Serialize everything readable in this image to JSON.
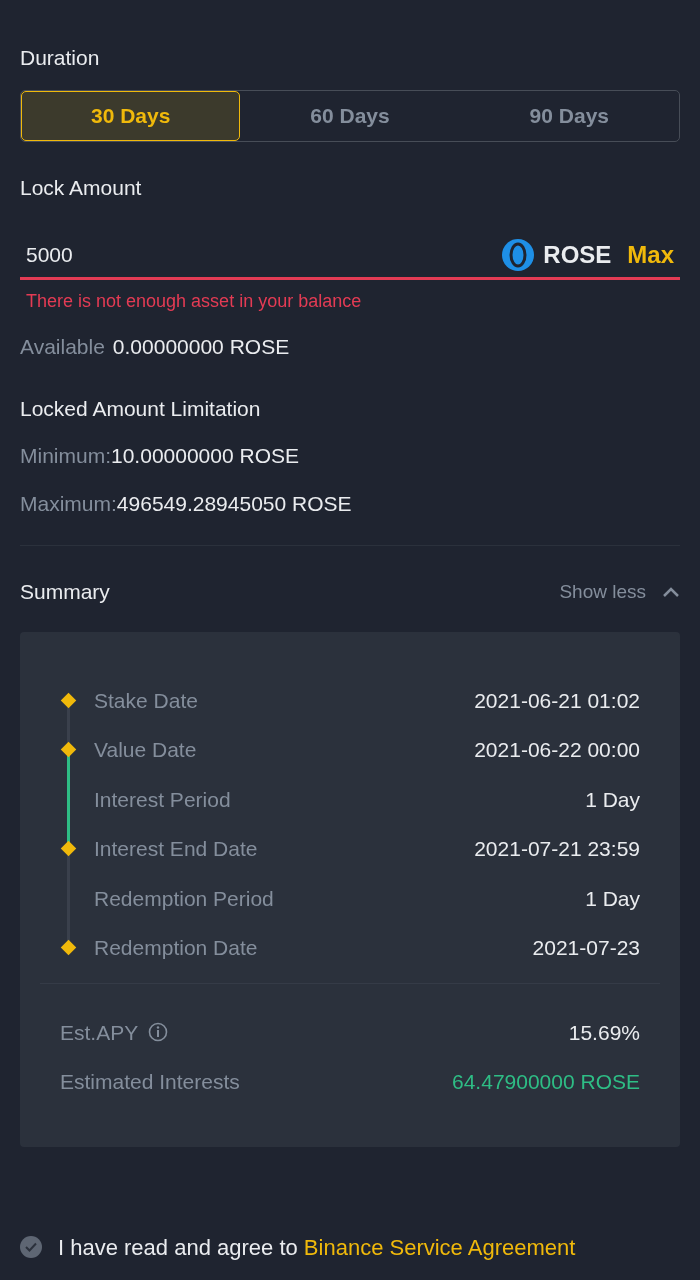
{
  "duration": {
    "label": "Duration",
    "options": [
      {
        "label": "30 Days",
        "selected": true
      },
      {
        "label": "60 Days",
        "selected": false
      },
      {
        "label": "90 Days",
        "selected": false
      }
    ]
  },
  "lock_amount": {
    "label": "Lock Amount",
    "value": "5000",
    "invalid": true,
    "asset": "ROSE",
    "max_label": "Max",
    "error": "There is not enough asset in your balance"
  },
  "available": {
    "label": "Available",
    "value": "0.00000000 ROSE"
  },
  "limitation": {
    "title": "Locked Amount Limitation",
    "items": [
      {
        "label": "Minimum:",
        "value": "10.00000000 ROSE"
      },
      {
        "label": "Maximum:",
        "value": "496549.28945050 ROSE"
      }
    ]
  },
  "summary": {
    "title": "Summary",
    "toggle": "Show less",
    "expanded": true,
    "timeline": [
      {
        "label": "Stake Date",
        "value": "2021-06-21 01:02",
        "kind": "date",
        "active": false
      },
      {
        "label": "Value Date",
        "value": "2021-06-22 00:00",
        "kind": "date",
        "active": false
      },
      {
        "label": "Interest Period",
        "value": "1 Day",
        "kind": "period",
        "active": true
      },
      {
        "label": "Interest End Date",
        "value": "2021-07-21 23:59",
        "kind": "date",
        "active": false
      },
      {
        "label": "Redemption Period",
        "value": "1 Day",
        "kind": "period",
        "active": false
      },
      {
        "label": "Redemption Date",
        "value": "2021-07-23",
        "kind": "date",
        "active": false
      }
    ],
    "stats": [
      {
        "label": "Est.APY",
        "value": "15.69%",
        "info": true,
        "positive": false
      },
      {
        "label": "Estimated Interests",
        "value": "64.47900000 ROSE",
        "info": false,
        "positive": true
      }
    ]
  },
  "agreement": {
    "checked": true,
    "text": "I have read and agree to",
    "link": "Binance Service Agreement"
  }
}
